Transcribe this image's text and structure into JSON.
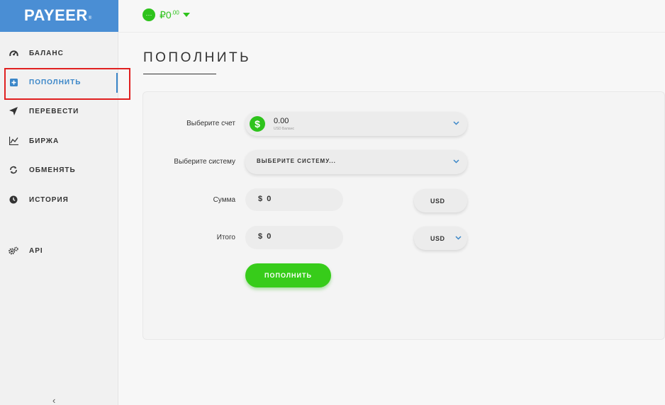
{
  "app": {
    "logo": "PAYEER",
    "logo_mark": "®"
  },
  "sidebar": {
    "items": [
      {
        "label": "БАЛАНС",
        "icon": "gauge-icon"
      },
      {
        "label": "ПОПОЛНИТЬ",
        "icon": "plus-square-icon",
        "active": true
      },
      {
        "label": "ПЕРЕВЕСТИ",
        "icon": "paper-plane-icon"
      },
      {
        "label": "БИРЖА",
        "icon": "chart-line-icon"
      },
      {
        "label": "ОБМЕНЯТЬ",
        "icon": "exchange-arrows-icon"
      },
      {
        "label": "ИСТОРИЯ",
        "icon": "clock-icon"
      },
      {
        "label": "API",
        "icon": "gears-icon"
      }
    ],
    "collapse_glyph": "‹"
  },
  "topbar": {
    "balance_icon_glyph": "···",
    "balance_integer": "₽0",
    "balance_decimals": ".00"
  },
  "page": {
    "title": "ПОПОЛНИТЬ"
  },
  "form": {
    "account": {
      "label": "Выберите счет",
      "value": "0.00",
      "sub": "USD Баланс",
      "dollar_glyph": "$"
    },
    "system": {
      "label": "Выберите систему",
      "value": "ВЫБЕРИТЕ СИСТЕМУ..."
    },
    "amount": {
      "label": "Сумма",
      "prefix": "$",
      "value": "0",
      "currency": "USD"
    },
    "total": {
      "label": "Итого",
      "prefix": "$",
      "value": "0",
      "currency": "USD"
    },
    "submit_label": "ПОПОЛНИТЬ"
  },
  "colors": {
    "brand_blue": "#4a8ed4",
    "accent_green": "#37cc1a",
    "active_blue": "#3a86c8",
    "highlight_red": "#e02020"
  }
}
